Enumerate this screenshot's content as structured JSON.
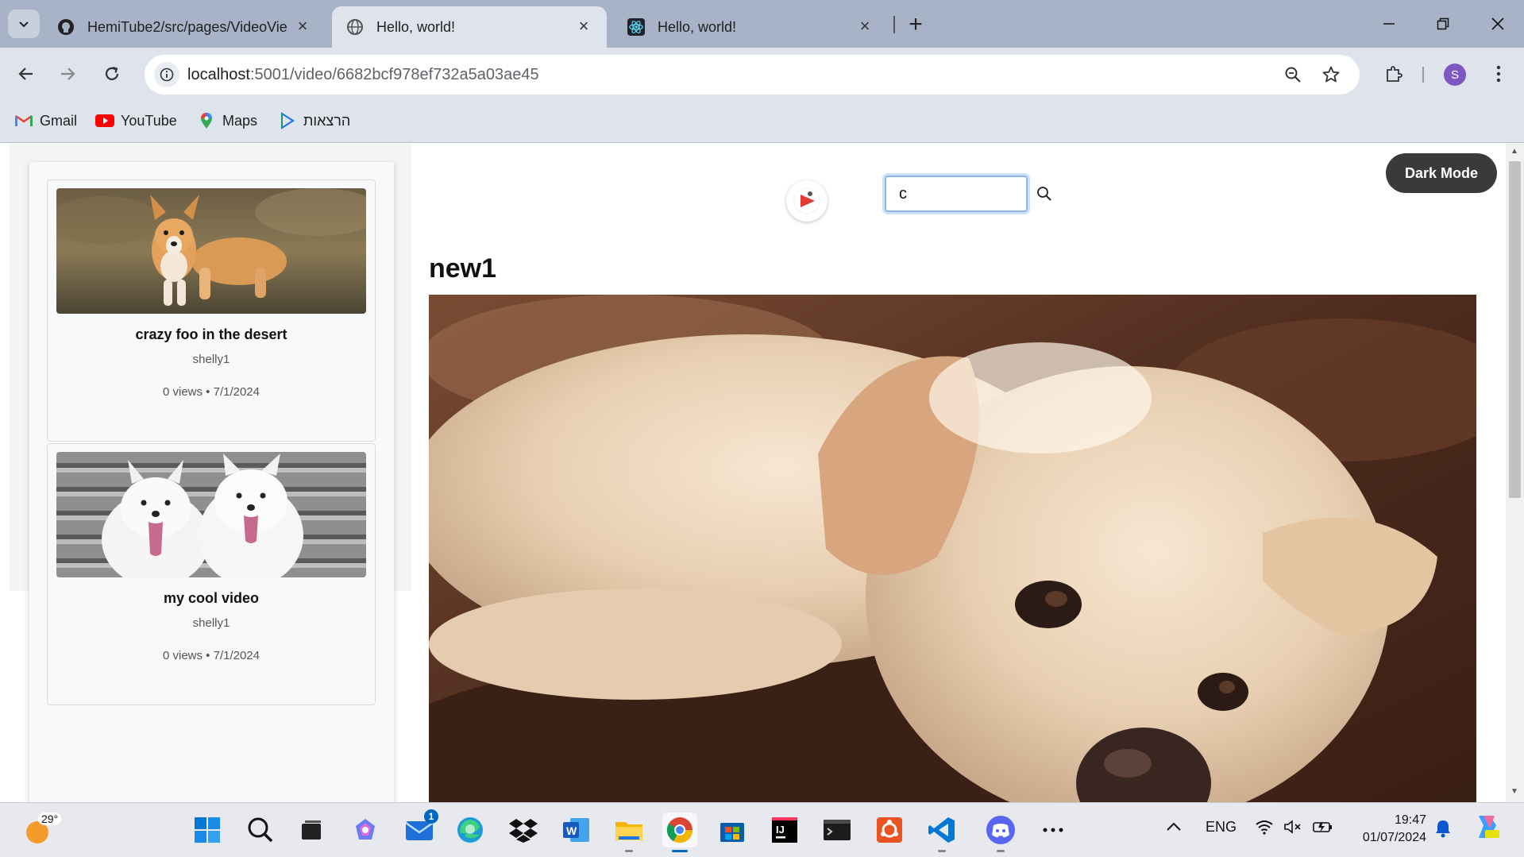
{
  "browser": {
    "tabs": [
      {
        "title": "HemiTube2/src/pages/VideoVie",
        "icon": "github-icon",
        "active": false
      },
      {
        "title": "Hello, world!",
        "icon": "globe-icon",
        "active": true
      },
      {
        "title": "Hello, world!",
        "icon": "react-icon",
        "active": false
      }
    ],
    "url_host": "localhost",
    "url_path": ":5001/video/6682bcf978ef732a5a03ae45",
    "profile_initial": "S",
    "bookmarks": [
      {
        "label": "Gmail",
        "icon": "gmail-icon"
      },
      {
        "label": "YouTube",
        "icon": "youtube-icon"
      },
      {
        "label": "Maps",
        "icon": "maps-icon"
      },
      {
        "label": "הרצאות",
        "icon": "drive-icon"
      }
    ]
  },
  "page": {
    "sidebar": {
      "videos": [
        {
          "title": "crazy foo in the desert",
          "author": "shelly1",
          "meta": "0 views • 7/1/2024",
          "thumb": "corgi"
        },
        {
          "title": "my cool video",
          "author": "shelly1",
          "meta": "0 views • 7/1/2024",
          "thumb": "samoyeds"
        }
      ]
    },
    "search": {
      "value": "c"
    },
    "dark_mode_label": "Dark Mode",
    "video_title": "new1"
  },
  "taskbar": {
    "weather_temp": "29°",
    "mail_badge": "1",
    "language": "ENG",
    "time": "19:47",
    "date": "01/07/2024"
  }
}
